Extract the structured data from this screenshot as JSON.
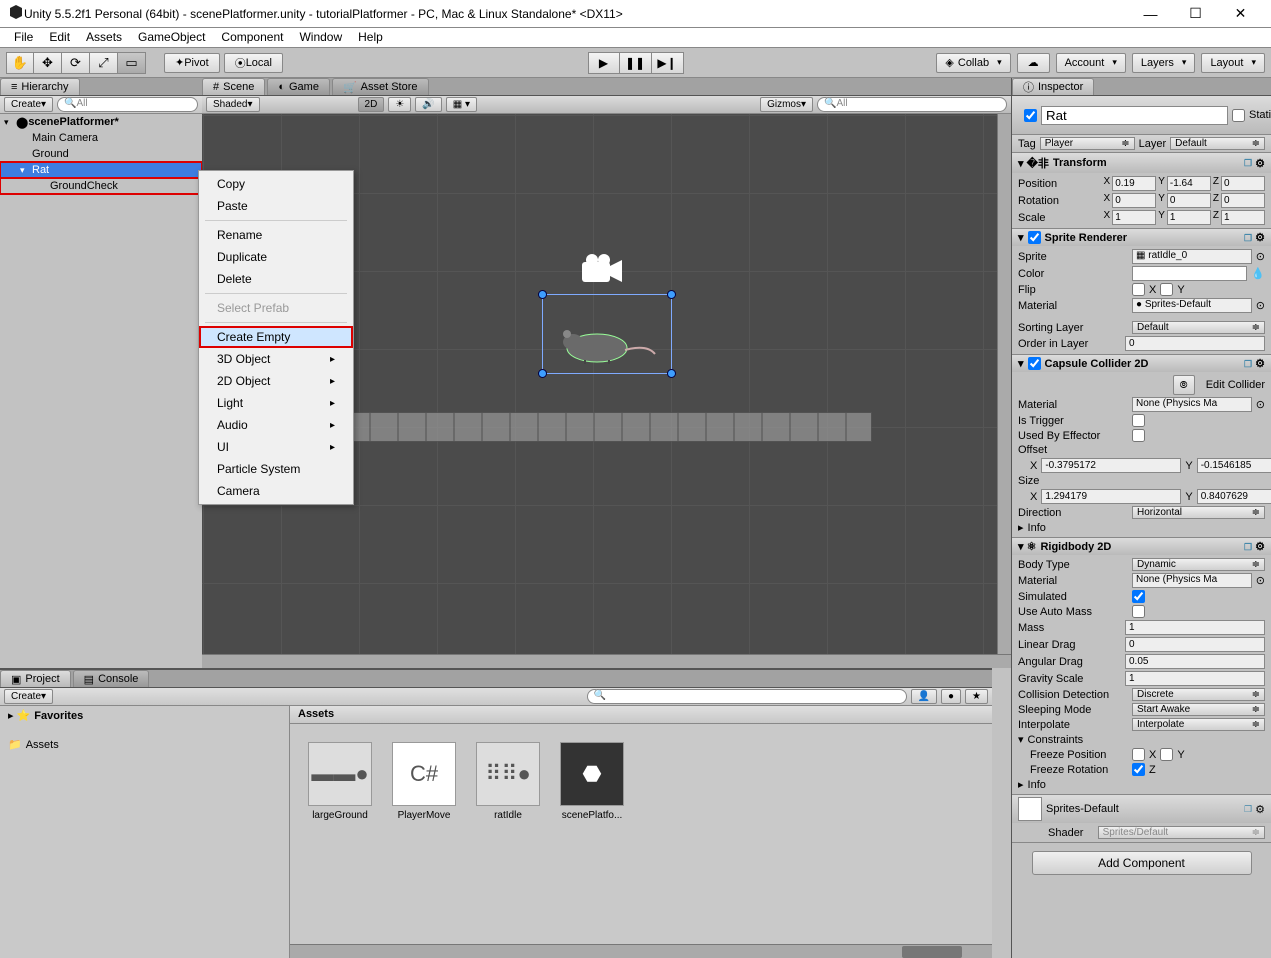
{
  "window": {
    "title": "Unity 5.5.2f1 Personal (64bit) - scenePlatformer.unity - tutorialPlatformer - PC, Mac & Linux Standalone* <DX11>"
  },
  "menu": [
    "File",
    "Edit",
    "Assets",
    "GameObject",
    "Component",
    "Window",
    "Help"
  ],
  "toolbar": {
    "pivot": "Pivot",
    "local": "Local",
    "collab": "Collab",
    "account": "Account",
    "layers": "Layers",
    "layout": "Layout"
  },
  "hierarchy": {
    "tab": "Hierarchy",
    "create": "Create",
    "search_placeholder": "All",
    "scene": "scenePlatformer*",
    "items": [
      {
        "name": "Main Camera",
        "indent": 20
      },
      {
        "name": "Ground",
        "indent": 20
      },
      {
        "name": "Rat",
        "indent": 20,
        "selected": true,
        "highlight": true,
        "expandable": true
      },
      {
        "name": "GroundCheck",
        "indent": 38,
        "highlight": true
      }
    ]
  },
  "context_menu": {
    "items": [
      {
        "label": "Copy"
      },
      {
        "label": "Paste"
      },
      {
        "sep": true
      },
      {
        "label": "Rename"
      },
      {
        "label": "Duplicate"
      },
      {
        "label": "Delete"
      },
      {
        "sep": true
      },
      {
        "label": "Select Prefab",
        "disabled": true
      },
      {
        "sep": true
      },
      {
        "label": "Create Empty",
        "selected": true
      },
      {
        "label": "3D Object",
        "submenu": true
      },
      {
        "label": "2D Object",
        "submenu": true
      },
      {
        "label": "Light",
        "submenu": true
      },
      {
        "label": "Audio",
        "submenu": true
      },
      {
        "label": "UI",
        "submenu": true
      },
      {
        "label": "Particle System"
      },
      {
        "label": "Camera"
      }
    ]
  },
  "scene_tabs": {
    "scene": "Scene",
    "game": "Game",
    "store": "Asset Store"
  },
  "scene_toolbar": {
    "shaded": "Shaded",
    "mode2d": "2D",
    "gizmos": "Gizmos",
    "search_placeholder": "All"
  },
  "project": {
    "tab": "Project",
    "console": "Console",
    "create": "Create",
    "favorites": "Favorites",
    "assets_folder": "Assets",
    "header": "Assets",
    "items": [
      "largeGround",
      "PlayerMove",
      "ratIdle",
      "scenePlatfo..."
    ]
  },
  "inspector": {
    "tab": "Inspector",
    "name": "Rat",
    "static": "Static",
    "tag_label": "Tag",
    "tag_value": "Player",
    "layer_label": "Layer",
    "layer_value": "Default",
    "transform": {
      "title": "Transform",
      "position": {
        "label": "Position",
        "x": "0.19",
        "y": "-1.64",
        "z": "0"
      },
      "rotation": {
        "label": "Rotation",
        "x": "0",
        "y": "0",
        "z": "0"
      },
      "scale": {
        "label": "Scale",
        "x": "1",
        "y": "1",
        "z": "1"
      }
    },
    "sprite_renderer": {
      "title": "Sprite Renderer",
      "sprite_label": "Sprite",
      "sprite_value": "ratIdle_0",
      "color_label": "Color",
      "flip_label": "Flip",
      "flip_x": "X",
      "flip_y": "Y",
      "material_label": "Material",
      "material_value": "Sprites-Default",
      "sorting_layer_label": "Sorting Layer",
      "sorting_layer_value": "Default",
      "order_label": "Order in Layer",
      "order_value": "0"
    },
    "capsule": {
      "title": "Capsule Collider 2D",
      "edit_collider": "Edit Collider",
      "material_label": "Material",
      "material_value": "None (Physics Ma",
      "is_trigger": "Is Trigger",
      "used_by_effector": "Used By Effector",
      "offset_label": "Offset",
      "offset_x": "-0.3795172",
      "offset_y": "-0.1546185",
      "size_label": "Size",
      "size_x": "1.294179",
      "size_y": "0.8407629",
      "direction_label": "Direction",
      "direction_value": "Horizontal",
      "info": "Info"
    },
    "rigidbody": {
      "title": "Rigidbody 2D",
      "body_type_label": "Body Type",
      "body_type_value": "Dynamic",
      "material_label": "Material",
      "material_value": "None (Physics Ma",
      "simulated": "Simulated",
      "use_auto_mass": "Use Auto Mass",
      "mass_label": "Mass",
      "mass_value": "1",
      "linear_drag_label": "Linear Drag",
      "linear_drag_value": "0",
      "angular_drag_label": "Angular Drag",
      "angular_drag_value": "0.05",
      "gravity_label": "Gravity Scale",
      "gravity_value": "1",
      "collision_label": "Collision Detection",
      "collision_value": "Discrete",
      "sleeping_label": "Sleeping Mode",
      "sleeping_value": "Start Awake",
      "interpolate_label": "Interpolate",
      "interpolate_value": "Interpolate",
      "constraints": "Constraints",
      "freeze_pos": "Freeze Position",
      "fp_x": "X",
      "fp_y": "Y",
      "freeze_rot": "Freeze Rotation",
      "fr_z": "Z",
      "info": "Info"
    },
    "material_footer": {
      "name": "Sprites-Default",
      "shader_label": "Shader",
      "shader_value": "Sprites/Default"
    },
    "add_component": "Add Component"
  }
}
